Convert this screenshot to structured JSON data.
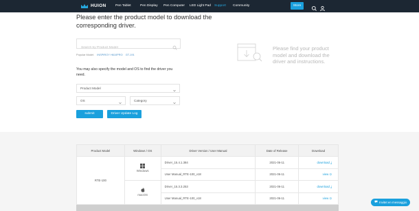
{
  "nav": {
    "brand": "HUION",
    "items": [
      {
        "label": "Pen Tablet"
      },
      {
        "label": "Pen Display"
      },
      {
        "label": "Pen Computer"
      },
      {
        "label": "LED Light Pad"
      },
      {
        "label": "Support"
      },
      {
        "label": "Community"
      }
    ],
    "active_index": 4,
    "store_label": "Store",
    "accent": "#1aa0dd",
    "background": "#1c2733"
  },
  "main": {
    "heading": "Please enter the product model to download the corresponding driver.",
    "search_placeholder": "Search by Product Model",
    "popular_label": "Popular Model:",
    "popular_models": [
      "INSPIROY H610PRO",
      "GT-191"
    ],
    "specify_text": "You may also specify the model and OS to find the driver you need.",
    "product_model_select": "Product Model",
    "os_select": "OS",
    "category_select": "Category",
    "submit_label": "submit",
    "driver_log_label": "Driver Update Log"
  },
  "side": {
    "text": "Please find your product model and download the driver and instructions."
  },
  "table": {
    "headers": [
      "Product Model",
      "Windows / OS",
      "Driver Version / User Manual",
      "Date of Release",
      "Download"
    ],
    "product": "RTE-100",
    "windows_label": "Windows",
    "mac_label": "macOS",
    "rows": [
      {
        "name": "Driver_15.4.1.384",
        "date": "2021-06-11",
        "action": "download ⤓"
      },
      {
        "name": "User Manual_RTE-100_v18",
        "date": "2021-06-11",
        "action": "view ⊙"
      },
      {
        "name": "Driver_15.3.3.253",
        "date": "2021-06-11",
        "action": "download ⤓"
      },
      {
        "name": "User Manual_RTE-100_v18",
        "date": "2021-06-11",
        "action": "view ⊙"
      }
    ]
  },
  "chat": {
    "label": "Invitet en messaggio"
  }
}
